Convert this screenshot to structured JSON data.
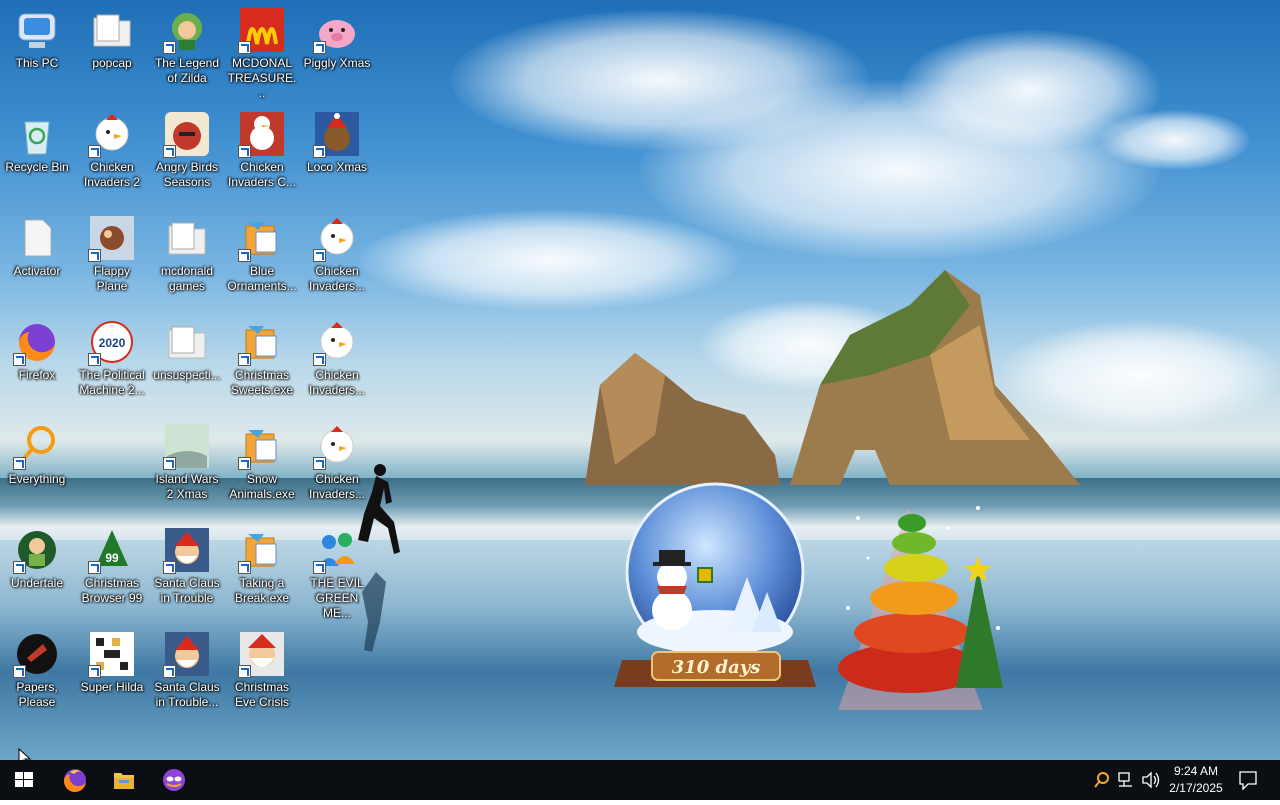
{
  "desktop_icons": [
    {
      "label": "This PC",
      "icon": "computer-icon"
    },
    {
      "label": "popcap",
      "icon": "folder-icon"
    },
    {
      "label": "The Legend of Zilda",
      "icon": "zilda-game-icon"
    },
    {
      "label": "MCDONAL TREASURE...",
      "icon": "mcdonalds-icon"
    },
    {
      "label": "Piggly Xmas",
      "icon": "pig-icon"
    },
    {
      "label": "Recycle Bin",
      "icon": "recycle-bin-icon"
    },
    {
      "label": "Chicken Invaders 2",
      "icon": "chicken-icon"
    },
    {
      "label": "Angry Birds Seasons",
      "icon": "angry-birds-icon"
    },
    {
      "label": "Chicken Invaders C...",
      "icon": "snowman-icon"
    },
    {
      "label": "Loco Xmas",
      "icon": "bear-icon"
    },
    {
      "label": "Activator",
      "icon": "file-icon"
    },
    {
      "label": "Flappy Plane",
      "icon": "plane-icon"
    },
    {
      "label": "mcdonald games",
      "icon": "folder-icon"
    },
    {
      "label": "Blue Ornaments...",
      "icon": "installer-icon"
    },
    {
      "label": "Chicken Invaders...",
      "icon": "chicken-icon"
    },
    {
      "label": "Firefox",
      "icon": "firefox-icon"
    },
    {
      "label": "The Political Machine 2...",
      "icon": "political-machine-icon"
    },
    {
      "label": "unsuspecti...",
      "icon": "folder-icon"
    },
    {
      "label": "Christmas Sweets.exe",
      "icon": "installer-icon"
    },
    {
      "label": "Chicken Invaders...",
      "icon": "chicken-icon"
    },
    {
      "label": "Everything",
      "icon": "magnifier-icon"
    },
    {
      "label": "Island Wars 2 Xmas",
      "icon": "island-icon"
    },
    {
      "label": "Snow Animals.exe",
      "icon": "installer-icon"
    },
    {
      "label": "Chicken Invaders...",
      "icon": "chicken-icon"
    },
    {
      "label": "Undertale",
      "icon": "undertale-icon"
    },
    {
      "label": "Christmas Browser 99",
      "icon": "tree-icon"
    },
    {
      "label": "Santa Claus in Trouble",
      "icon": "santa-icon"
    },
    {
      "label": "Taking a Break.exe",
      "icon": "installer-icon"
    },
    {
      "label": "THE EVIL GREEN ME...",
      "icon": "people-icon"
    },
    {
      "label": "Papers, Please",
      "icon": "papers-please-icon"
    },
    {
      "label": "Super Hilda",
      "icon": "pixel-icon"
    },
    {
      "label": "Santa Claus in Trouble...",
      "icon": "santa-icon"
    },
    {
      "label": "Christmas Eve Crisis",
      "icon": "santa-face-icon"
    }
  ],
  "snowglobe": {
    "countdown": "310 days"
  },
  "taskbar": {
    "start": "windows-logo-icon",
    "pinned": [
      "firefox-icon",
      "file-explorer-icon",
      "mask-app-icon"
    ],
    "tray": {
      "time": "9:24 AM",
      "date": "2/17/2025"
    }
  }
}
